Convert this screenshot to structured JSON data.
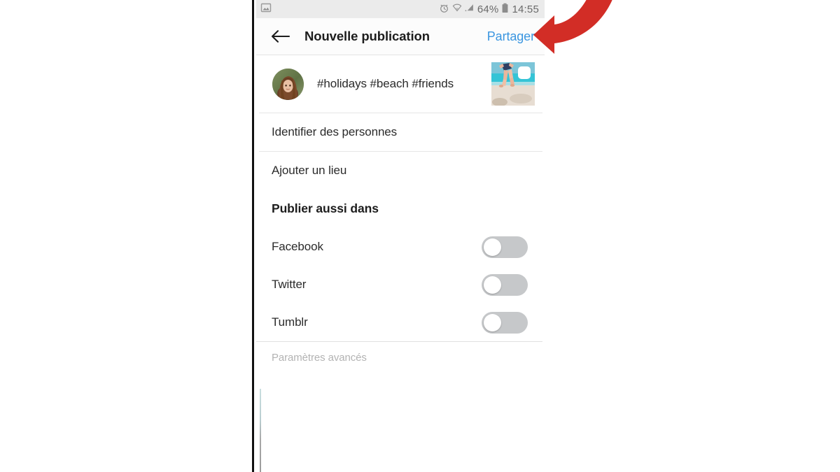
{
  "device": {
    "status_bar": {
      "left_icons": [
        "screenshot-image-icon"
      ],
      "right_icons": [
        "alarm-clock-icon",
        "wifi-icon",
        "cellular-signal-icon",
        "battery-icon"
      ],
      "battery_percent": "64%",
      "clock": "14:55"
    }
  },
  "app_bar": {
    "back_icon": "arrow-left-icon",
    "title": "Nouvelle publication",
    "share_label": "Partager"
  },
  "caption": {
    "avatar_name": "user-avatar",
    "text": "#holidays #beach #friends",
    "thumbnail_name": "post-thumbnail-beach",
    "multi_photo_badge": "multi-photo-icon"
  },
  "menu_rows": [
    {
      "label": "Identifier des personnes"
    },
    {
      "label": "Ajouter un lieu"
    }
  ],
  "share_section": {
    "header": "Publier aussi dans",
    "toggles": [
      {
        "label": "Facebook",
        "state": "off"
      },
      {
        "label": "Twitter",
        "state": "off"
      },
      {
        "label": "Tumblr",
        "state": "off"
      }
    ]
  },
  "advanced": {
    "label": "Paramètres avancés"
  },
  "annotation": {
    "type": "curved-arrow",
    "points_to": "Partager",
    "color": "#d22d26"
  },
  "colors": {
    "accent_blue": "#3b96e0",
    "status_bar_bg": "#ebebeb",
    "app_bar_bg": "#fcfcfc",
    "toggle_off": "#c6c8ca",
    "divider": "#e6e6e6",
    "muted_text": "#b3b3b3",
    "annotation_red": "#d22d26"
  }
}
